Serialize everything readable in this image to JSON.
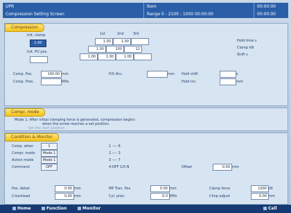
{
  "titlebar": {
    "screen_id": "UPR",
    "screen_name": "Compression Setting Screen",
    "label_mid": "Item",
    "range_text": "Range 0 - 2100 : 1000 00:00:00",
    "time_top": "00:00:00",
    "time_bottom": "00:00:00"
  },
  "compression": {
    "title": "Compression",
    "initial_clamp_label": "Init. clamp",
    "initial_clamp_value": "1.00",
    "initial_pos_label": "Init. PU pos.",
    "col_headers": [
      "1st",
      "2nd",
      "3rd"
    ],
    "row1": [
      "1.00",
      "1.00",
      ""
    ],
    "row2": [
      "1.00",
      "100",
      "12"
    ],
    "row3": [
      "1.00",
      "1.00",
      "1.00",
      ""
    ],
    "right_labels": [
      "Hold time s",
      "Clamp kN",
      "Shift s"
    ],
    "comp_pos_label": "Comp. Pos.",
    "comp_pos_value": "100.00",
    "comp_pos_unit": "mm",
    "comp_pres_label": "Comp. Pres.",
    "comp_pres_unit": "MPa",
    "pp_acc_label": "P/U Acc.",
    "pp_acc_unit": "mm",
    "hold_shift_label": "Hold shift",
    "hold_shift_unit": "s",
    "hold_inc_label": "Hold inc.",
    "hold_inc_unit": "mm"
  },
  "mode": {
    "title": "Compr. mode",
    "desc_line1": "Mode 1: After initial clamping force is generated, compression begins",
    "desc_line2": "when the screw reaches a set position.",
    "sub": "Set the start position"
  },
  "condition": {
    "title": "Condition & Monitor",
    "rows": [
      {
        "label": "Comp. when",
        "value": "1",
        "right": "1 ---- 6"
      },
      {
        "label": "Compr. mode",
        "value": "Mode 1",
        "right": "2 ---- 3"
      },
      {
        "label": "Action mode",
        "value": "Mode 1",
        "right": "3 ---- 7"
      },
      {
        "label": "Command",
        "value": "OFF",
        "right": "4:OFF 1/0 N"
      }
    ],
    "offset_label": "Offset",
    "offset_value": "0.00",
    "offset_unit": "mm",
    "pos_detail_label": "Pos. detail",
    "pos_detail_value": "0.00",
    "pos_detail_unit": "mm",
    "crosshead_label": "Crosshead",
    "crosshead_value": "0.00",
    "crosshead_unit": "mm",
    "mp_tran_label": "MP Tran. Pos",
    "mp_tran_value": "0.00",
    "mp_tran_unit": "mm",
    "cyl_pres_label": "Cyl. pres.",
    "cyl_pres_value": "0.0",
    "cyl_pres_unit": "MPa",
    "clamp_force_label": "Clamp force",
    "clamp_force_value": "1000",
    "clamp_force_unit": "kN",
    "clamp_adjust_label": "Clmp adjust",
    "clamp_adjust_value": "0.00",
    "clamp_adjust_unit": "mm"
  },
  "footer": {
    "home": "Home",
    "function": "Function",
    "monitor": "Monitor",
    "call": "Call"
  }
}
